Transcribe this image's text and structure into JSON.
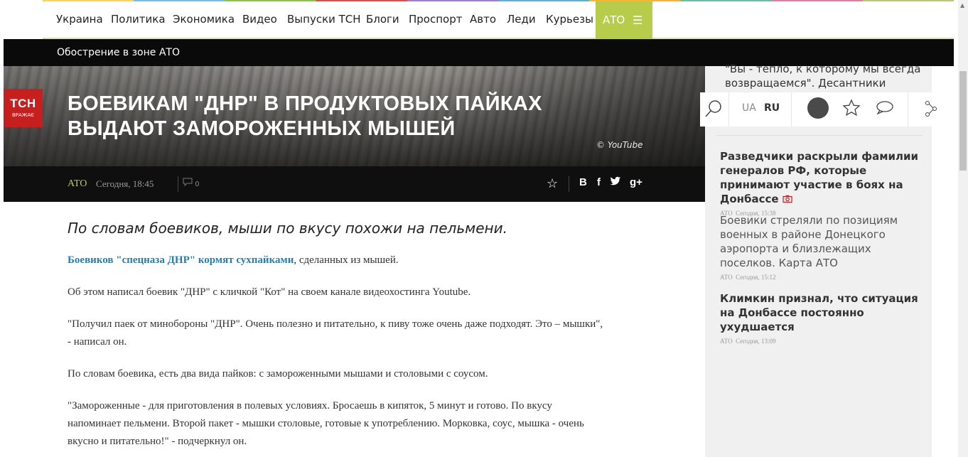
{
  "nav": {
    "items": [
      "Украина",
      "Политика",
      "Экономика",
      "Видео",
      "Выпуски ТСН",
      "Блоги",
      "Проспорт",
      "Авто",
      "Леди",
      "Курьезы"
    ],
    "active": "АТО",
    "menu_icon": "hamburger-icon"
  },
  "subbar": {
    "label": "Обострение в зоне АТО"
  },
  "logo": {
    "text": "ТСН",
    "sub": "ВРАЖАЄ"
  },
  "article": {
    "title_line1": "БОЕВИКАМ \"ДНР\" В ПРОДУКТОВЫХ ПАЙКАХ",
    "title_line2": "ВЫДАЮТ ЗАМОРОЖЕННЫХ МЫШЕЙ",
    "photo_credit": "© YouTube",
    "tag": "АТО",
    "time": "Сегодня, 18:45",
    "comments": "0",
    "lead": "По словам боевиков, мыши по вкусу похожи на пельмени.",
    "p1_link": "Боевиков \"спецназа ДНР\" кормят сухпайками",
    "p1_rest": ", сделанных из мышей.",
    "p2": "Об этом написал боевик \"ДНР\" с кличкой \"Кот\" на своем канале видеохостинга Youtube.",
    "p3a": "\"Получил паек от минобороны \"ДНР\". Очень полезно и питательно, к пиву тоже очень даже подходят. Это – мышки\",",
    "p3b": "- написал он.",
    "p4": "По словам боевика, есть два вида пайков: с замороженными мышами и столовыми с соусом.",
    "p5a": "\"Замороженные - для приготовления в полевых условиях. Бросаешь в кипяток, 5 минут и готово. По вкусу",
    "p5b": "напоминает пельмени. Второй пакет - мышки столовые, готовые к употреблению. Морковка, соус, мышка - очень",
    "p5c": "вкусно и питательно!\" - подчеркнул он."
  },
  "share": {
    "b": "В",
    "f": "f",
    "t": "twitter-icon",
    "g": "g+"
  },
  "sidebar": {
    "top_line1": "\"Вы - тепло, к которому мы всегда",
    "top_line2": "возвращаемся\". Десантники",
    "lang_ua": "UA",
    "lang_ru": "RU",
    "news": [
      {
        "title": "Разведчики раскрыли фамилии генералов РФ, которые принимают участие в боях на Донбассе",
        "tag": "АТО",
        "time": "Сегодня, 15:38"
      },
      {
        "title": "Боевики стреляли по позициям военных в районе Донецкого аэропорта и близлежащих поселков. Карта АТО",
        "tag": "АТО",
        "time": "Сегодня, 15:12"
      },
      {
        "title": "Климкин признал, что ситуация на Донбассе постоянно ухудшается",
        "tag": "АТО",
        "time": "Сегодня, 13:09"
      }
    ]
  },
  "colors": {
    "accent": "#b7cc4a",
    "brand_red": "#c71e1e",
    "link": "#1e7fbd"
  }
}
